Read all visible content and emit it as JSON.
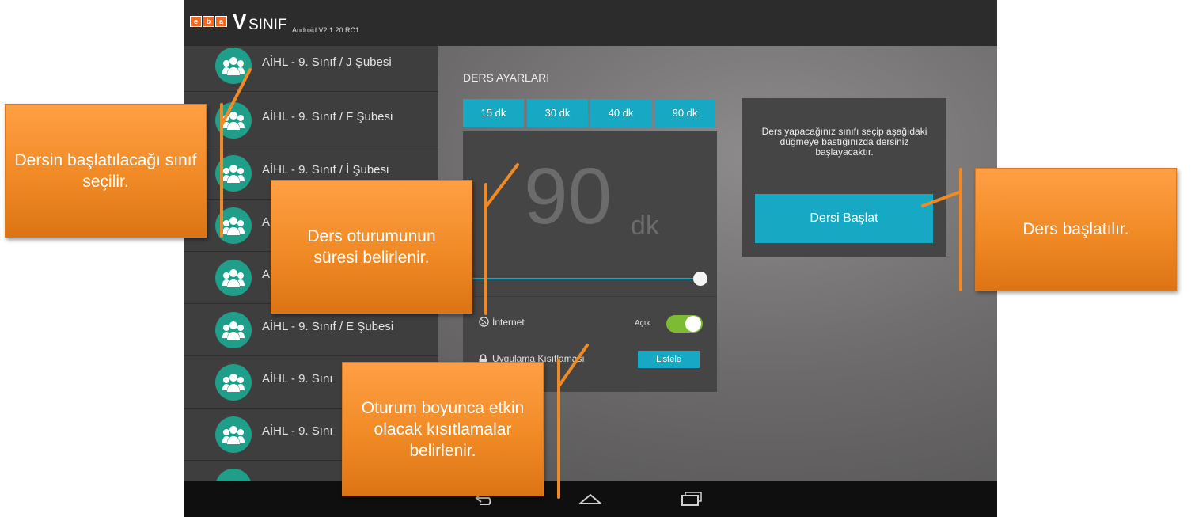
{
  "app": {
    "logo_letters": [
      "e",
      "b",
      "a"
    ],
    "name_v": "V",
    "name_rest": "SINIF",
    "version": "Android V2.1.20 RC1"
  },
  "class_list": [
    {
      "label": "AİHL -  9. Sınıf / J Şubesi"
    },
    {
      "label": "AİHL -  9. Sınıf / F Şubesi"
    },
    {
      "label": "AİHL -  9. Sınıf / İ Şubesi"
    },
    {
      "label": "A"
    },
    {
      "label": "A"
    },
    {
      "label": "AİHL -  9. Sınıf / E Şubesi"
    },
    {
      "label": "AİHL -  9. Sını"
    },
    {
      "label": "AİHL -  9. Sını"
    },
    {
      "label": ""
    }
  ],
  "settings": {
    "title": "DERS AYARLARI",
    "durations": [
      "15 dk",
      "30 dk",
      "40 dk",
      "90 dk"
    ],
    "selected_duration_value": "90",
    "selected_duration_unit": "dk",
    "internet_label": "İnternet",
    "internet_state": "Açık",
    "internet_enabled": true,
    "restrictions_label": "Uygulama Kısıtlaması",
    "list_button": "Listele"
  },
  "start": {
    "info": "Ders yapacağınız sınıfı seçip aşağıdaki düğmeye bastığınızda dersiniz başlayacaktır.",
    "button": "Dersi Başlat"
  },
  "callouts": {
    "class_select": "Dersin başlatılacağı sınıf seçilir.",
    "duration": "Ders oturumunun süresi belirlenir.",
    "restrictions": "Oturum boyunca etkin olacak kısıtlamalar belirlenir.",
    "start": "Ders başlatılır."
  },
  "colors": {
    "accent": "#17a9c3",
    "avatar": "#1f9e8a",
    "toggle_on": "#7ebb35",
    "callout": "#f08a25"
  },
  "icons": [
    "class-group-icon",
    "globe-icon",
    "lock-icon",
    "back-icon",
    "home-icon",
    "recent-apps-icon"
  ]
}
